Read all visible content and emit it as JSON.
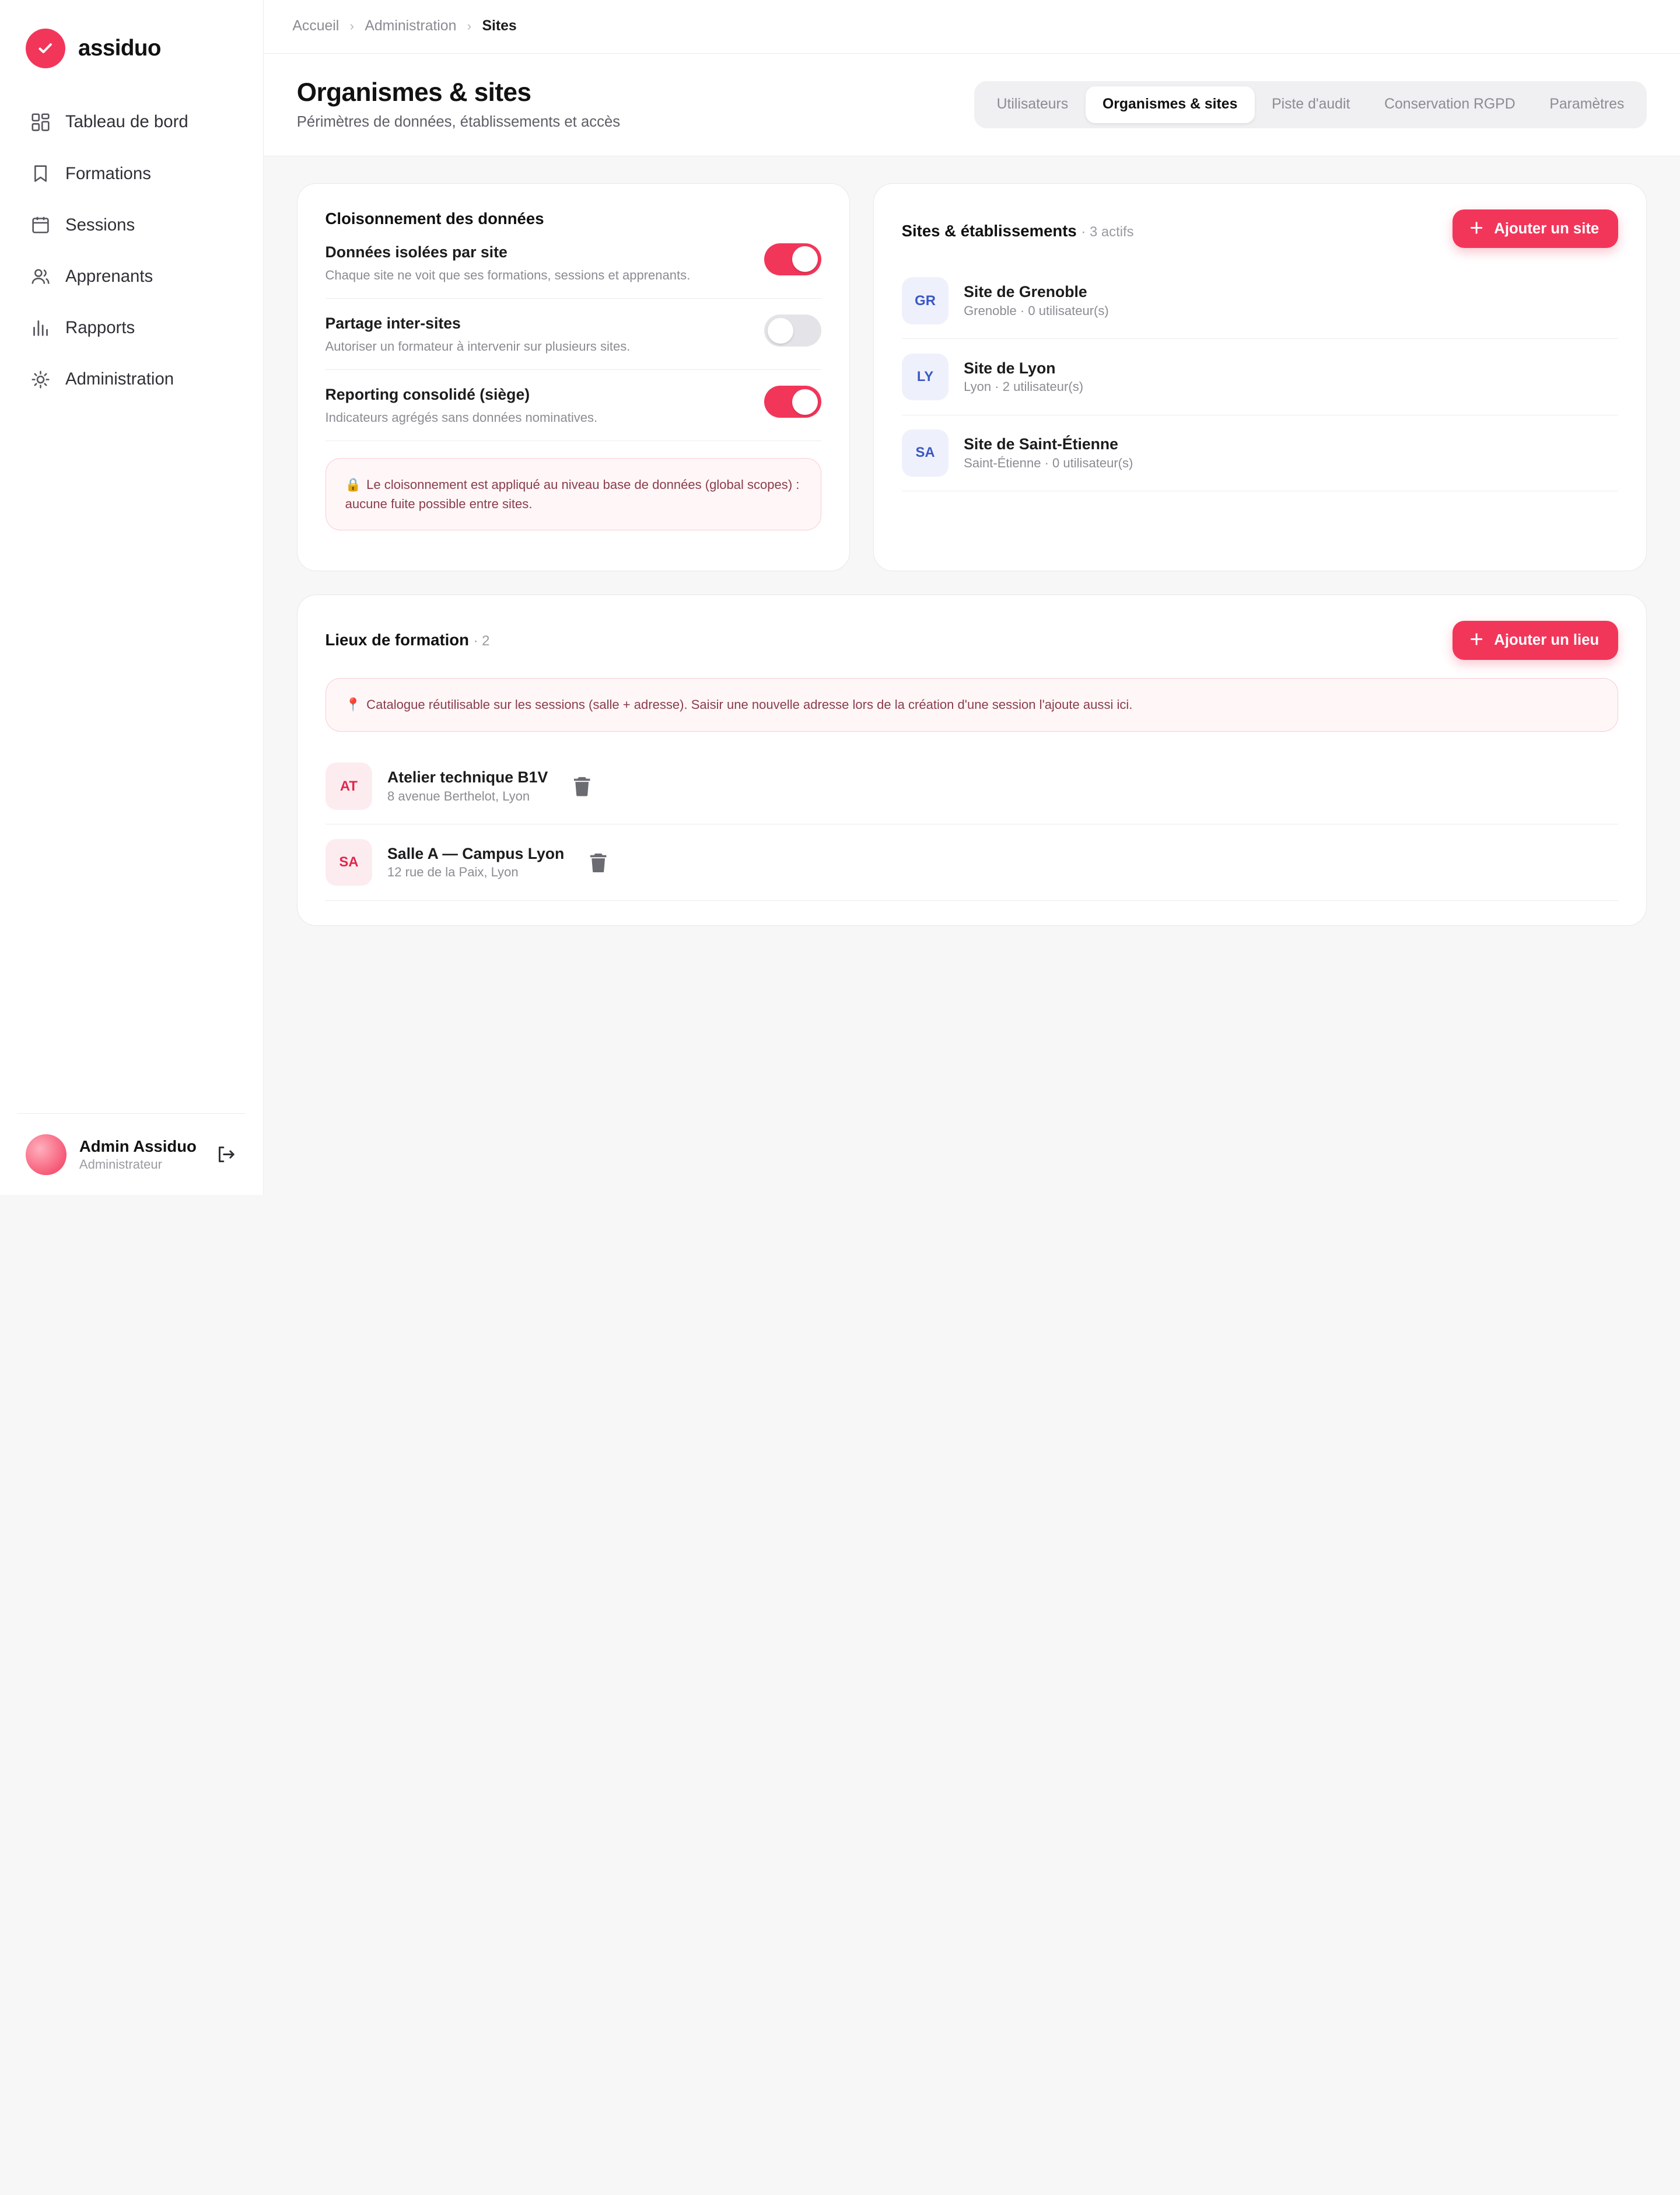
{
  "brand": {
    "name": "assiduo",
    "accent": "#f2365a"
  },
  "sidebar": {
    "items": [
      {
        "label": "Tableau de bord",
        "icon": "dashboard-icon"
      },
      {
        "label": "Formations",
        "icon": "bookmark-icon"
      },
      {
        "label": "Sessions",
        "icon": "calendar-icon"
      },
      {
        "label": "Apprenants",
        "icon": "users-icon"
      },
      {
        "label": "Rapports",
        "icon": "bar-chart-icon"
      },
      {
        "label": "Administration",
        "icon": "gear-icon"
      }
    ],
    "user": {
      "name": "Admin Assiduo",
      "role": "Administrateur"
    }
  },
  "breadcrumb": [
    "Accueil",
    "Administration",
    "Sites"
  ],
  "header": {
    "title": "Organismes & sites",
    "subtitle": "Périmètres de données, établissements et accès",
    "tabs": [
      {
        "label": "Utilisateurs",
        "active": false
      },
      {
        "label": "Organismes & sites",
        "active": true
      },
      {
        "label": "Piste d'audit",
        "active": false
      },
      {
        "label": "Conservation RGPD",
        "active": false
      },
      {
        "label": "Paramètres",
        "active": false
      }
    ]
  },
  "cloisonnement": {
    "title": "Cloisonnement des données",
    "settings": [
      {
        "label": "Données isolées par site",
        "desc": "Chaque site ne voit que ses formations, sessions et apprenants.",
        "enabled": true
      },
      {
        "label": "Partage inter-sites",
        "desc": "Autoriser un formateur à intervenir sur plusieurs sites.",
        "enabled": false
      },
      {
        "label": "Reporting consolidé (siège)",
        "desc": "Indicateurs agrégés sans données nominatives.",
        "enabled": true
      }
    ],
    "notice_icon": "🔒",
    "notice": "Le cloisonnement est appliqué au niveau base de données (global scopes) : aucune fuite possible entre sites."
  },
  "sites": {
    "title": "Sites & établissements",
    "count": "· 3 actifs",
    "add_label": "Ajouter un site",
    "items": [
      {
        "initials": "GR",
        "name": "Site de Grenoble",
        "meta": "Grenoble · 0 utilisateur(s)"
      },
      {
        "initials": "LY",
        "name": "Site de Lyon",
        "meta": "Lyon · 2 utilisateur(s)"
      },
      {
        "initials": "SA",
        "name": "Site de Saint-Étienne",
        "meta": "Saint-Étienne · 0 utilisateur(s)"
      }
    ]
  },
  "lieux": {
    "title": "Lieux de formation",
    "count": "· 2",
    "add_label": "Ajouter un lieu",
    "notice_icon": "📍",
    "notice": "Catalogue réutilisable sur les sessions (salle + adresse). Saisir une nouvelle adresse lors de la création d'une session l'ajoute aussi ici.",
    "items": [
      {
        "initials": "AT",
        "name": "Atelier technique B1V",
        "address": "8 avenue Berthelot, Lyon"
      },
      {
        "initials": "SA",
        "name": "Salle A — Campus Lyon",
        "address": "12 rue de la Paix, Lyon"
      }
    ]
  }
}
